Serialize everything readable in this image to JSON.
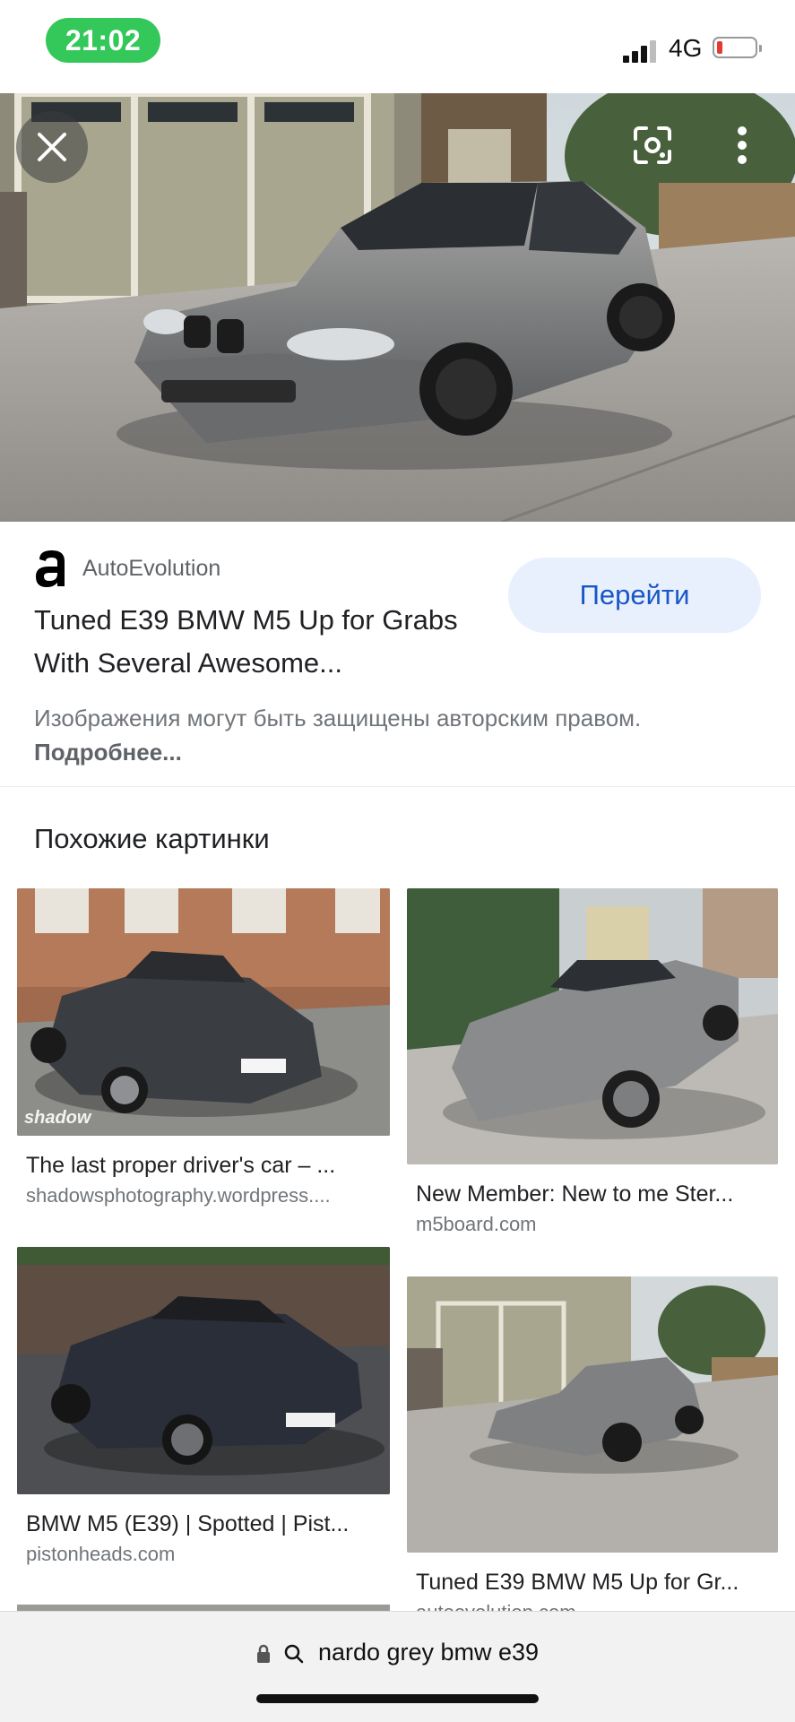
{
  "status": {
    "time": "21:02",
    "network": "4G",
    "battery_level": 0.12
  },
  "viewer": {
    "close_icon": "close-icon",
    "lens_icon": "lens-icon",
    "more_icon": "more-vert-icon"
  },
  "result": {
    "source_name": "AutoEvolution",
    "title": "Tuned E39 BMW M5 Up for Grabs With Several Awesome...",
    "visit_label": "Перейти",
    "copyright_text": "Изображения могут быть защищены авторским правом.",
    "more_link": "Подробнее..."
  },
  "similar": {
    "heading": "Похожие картинки",
    "items": [
      {
        "caption": "The last proper driver's car – ...",
        "domain": "shadowsphotography.wordpress...."
      },
      {
        "caption": "New Member: New to me Ster...",
        "domain": "m5board.com"
      },
      {
        "caption": "BMW M5 (E39) | Spotted | Pist...",
        "domain": "pistonheads.com"
      },
      {
        "caption": "Tuned E39 BMW M5 Up for Gr...",
        "domain": "autoevolution.com"
      }
    ]
  },
  "search": {
    "query": "nardo grey bmw e39"
  },
  "colors": {
    "accent": "#1a56c6",
    "visit_bg": "#e8f0fe",
    "time_pill": "#34c759"
  }
}
